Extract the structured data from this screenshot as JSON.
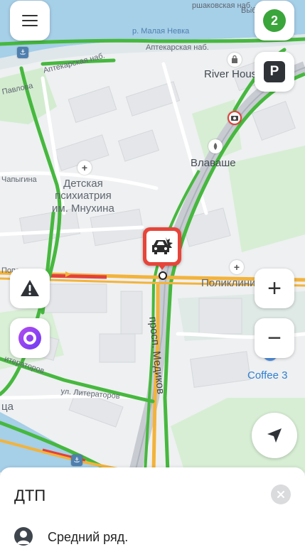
{
  "map": {
    "labels": {
      "embankment_top": "ршаковская наб.",
      "vyb": "Выб",
      "malaya_nevka": "р. Малая Невка",
      "apothecary_left": "Аптекарская наб.",
      "apothecary_center": "Аптекарская наб.",
      "river_house": "River House",
      "pavlova": "Павлова",
      "chapygina": "Чапыгина",
      "hospital": "Детская\nпсихиатрия\nим. Мнухина",
      "vlavashe": "Влаваше",
      "popova": "Попова",
      "poliklinika": "Поликлини",
      "medikov": "просп. Медиков",
      "literatorov": "ул. Литераторов",
      "literatorov_left": "итераторов",
      "tsa": "ца",
      "coffee": "Coffee 3"
    },
    "incident_marker": "car-crash",
    "colors": {
      "water": "#a6cfe8",
      "green_traffic": "#46b83e",
      "yellow_traffic": "#f3b33a",
      "red_traffic": "#e2413a",
      "incident": "#e7443a",
      "alice": "#8a3bf0"
    }
  },
  "controls": {
    "menu_icon": "hamburger-menu-icon",
    "alerts_count": "2",
    "parking_label": "P",
    "zoom_in": "+",
    "zoom_out": "−"
  },
  "sheet": {
    "title": "ДТП",
    "close_icon": "close-icon",
    "detail_text": "Средний ряд."
  }
}
